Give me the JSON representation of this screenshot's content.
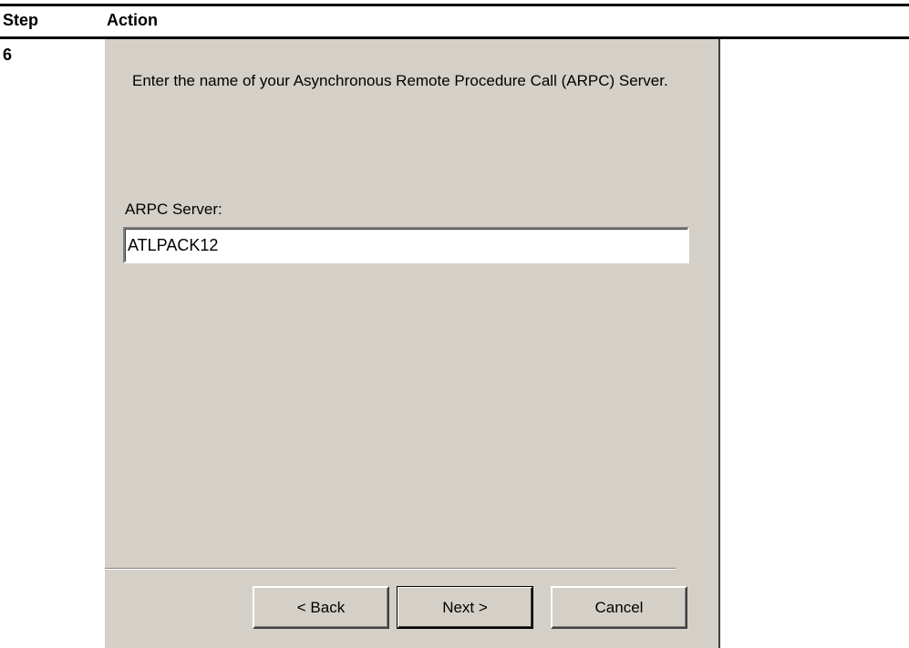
{
  "table": {
    "header_step": "Step",
    "header_action": "Action",
    "step_number": "6"
  },
  "dialog": {
    "instruction": "Enter the name of your Asynchronous Remote Procedure Call (ARPC) Server.",
    "field_label": "ARPC Server:",
    "field_value": "ATLPACK12",
    "buttons": {
      "back": "< Back",
      "next": "Next >",
      "cancel": "Cancel"
    },
    "colors": {
      "face": "#d4d0c8",
      "shadow": "#808080",
      "dark_shadow": "#404040"
    }
  }
}
